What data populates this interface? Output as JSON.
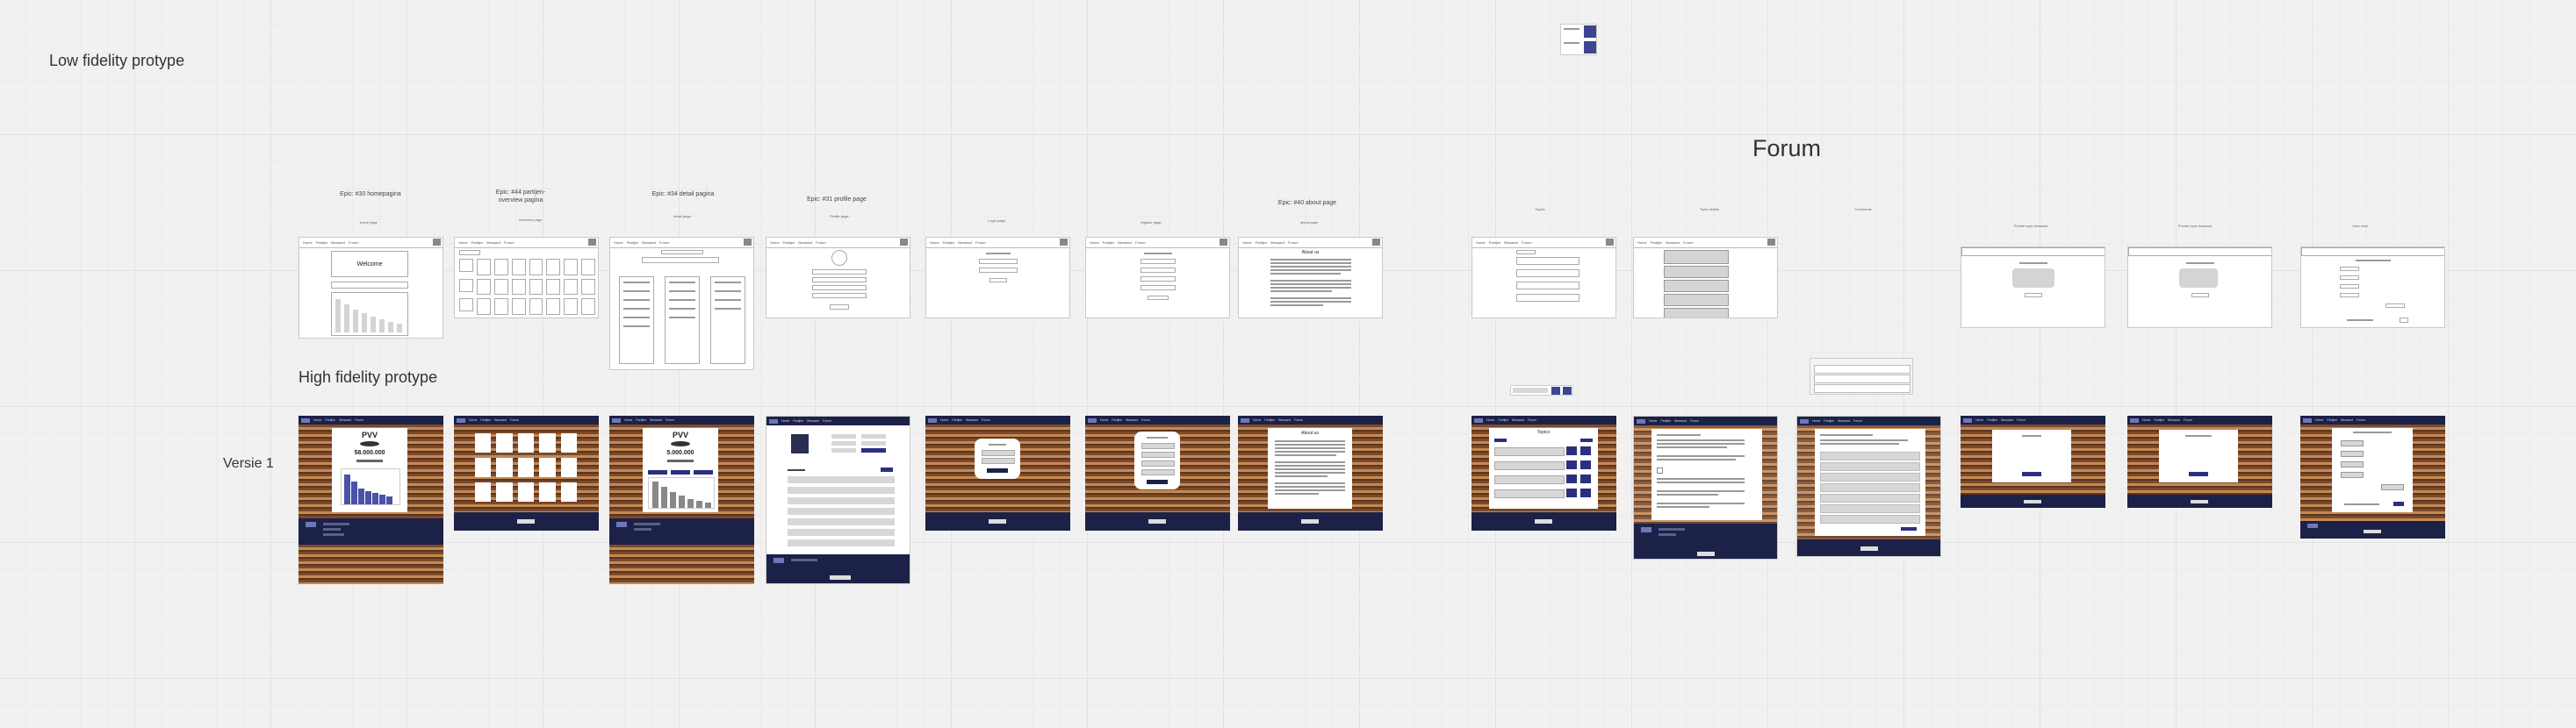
{
  "board": {
    "low_fidelity_label": "Low fidelity protype",
    "high_fidelity_label": "High fidelity protype",
    "version_label": "Versie 1",
    "forum_label": "Forum"
  },
  "epics": [
    "Epic: #30 homepagina",
    "Epic: #44 partijen-\noverview pagina",
    "Epic: #34 detail pagina",
    "Epic: #31 profile page",
    "Epic: #40 about page"
  ],
  "small_captions": [
    "home page",
    "Overview page",
    "detail page",
    "Profile page",
    "Login page",
    "register page",
    "about page",
    "Topics",
    "Topic details",
    "Comments",
    "Private topic bewaard",
    "Private topic bewaard",
    "User chat"
  ],
  "lowfi_nav": [
    "Home",
    "Partijen",
    "Bewaard",
    "Forum"
  ],
  "homepage": {
    "welcome": "Welcome",
    "party": "PVV",
    "votes": "58.000.000"
  },
  "detail": {
    "party": "PVV",
    "votes": "5.000.000"
  },
  "about_title": "About us",
  "topics_title": "Topics"
}
